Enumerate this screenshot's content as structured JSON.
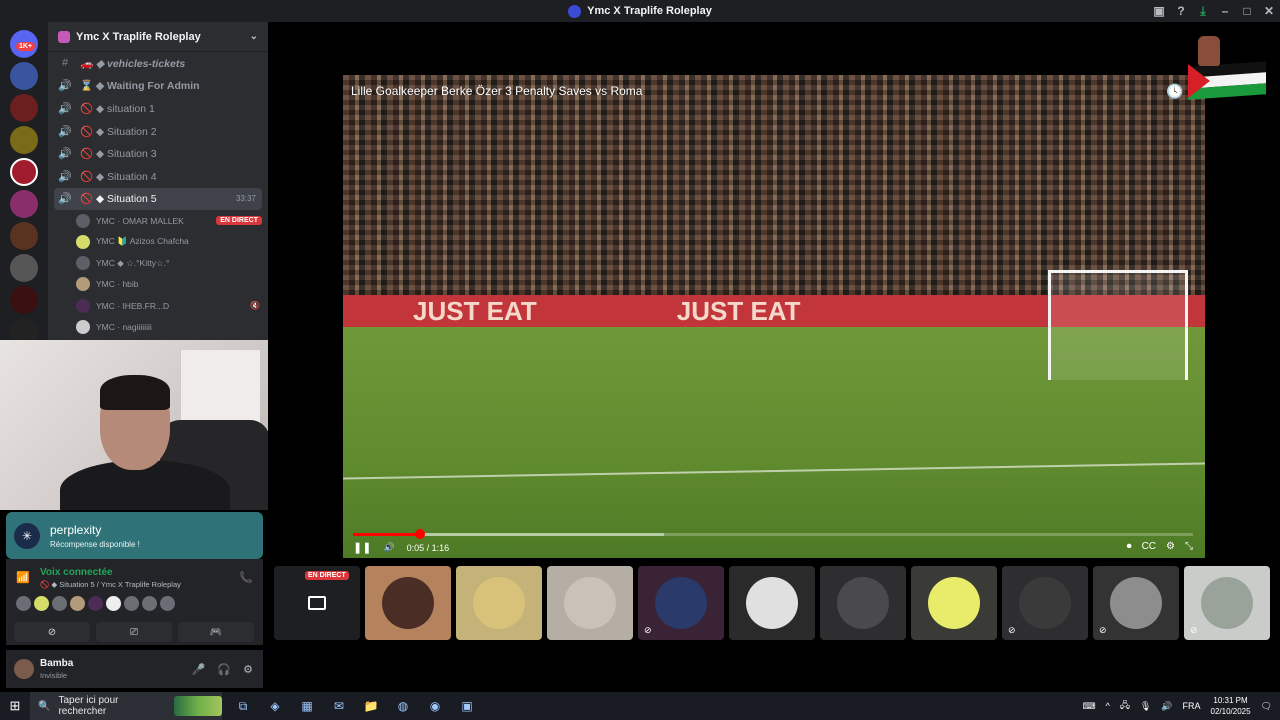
{
  "window": {
    "title": "Ymc X Traplife Roleplay"
  },
  "guilds": {
    "home_badge": "1K+"
  },
  "server": {
    "name": "Ymc X Traplife Roleplay",
    "channels": [
      {
        "label": "🚗 ◆ vehicles-tickets",
        "type": "text"
      },
      {
        "label": "⌛ ◆ Waiting For Admin",
        "type": "voice"
      },
      {
        "label": "🚫 ◆ situation 1",
        "type": "voice"
      },
      {
        "label": "🚫 ◆ Situation 2",
        "type": "voice"
      },
      {
        "label": "🚫 ◆ Situation 3",
        "type": "voice"
      },
      {
        "label": "🚫 ◆ Situation 4",
        "type": "voice"
      },
      {
        "label": "🚫 ◆ Situation 5",
        "type": "voice",
        "active": true,
        "time": "33:37"
      }
    ],
    "voice_users": [
      {
        "name": "YMC · OMAR MALLEK",
        "live": "EN DIRECT"
      },
      {
        "name": "YMC 🔰 Azizos Chafcha"
      },
      {
        "name": "YMC ◆ ☆.°Kitty☆.°"
      },
      {
        "name": "YMC · hbib"
      },
      {
        "name": "YMC · IHEB.FR...D",
        "muted": true
      },
      {
        "name": "YMC · nagiiiiiiii"
      }
    ]
  },
  "activity": {
    "app": "perplexity",
    "subtitle": "Récompense disponible !"
  },
  "voice": {
    "status": "Voix connectée",
    "channel": "🚫 ◆ Situation 5 / Ymc X Traplife Roleplay"
  },
  "user": {
    "name": "Bamba",
    "status": "Invisible"
  },
  "video": {
    "title": "Lille Goalkeeper Berke Özer 3 Penalty Saves vs Roma",
    "current_time": "0:05",
    "duration": "1:16",
    "time_display": "0:05 / 1:16",
    "progress": 0.08,
    "buffered": 0.37,
    "board_text": [
      "JUST EAT",
      "JUST EAT"
    ]
  },
  "participants": {
    "live_label": "EN DIRECT",
    "count": 10
  },
  "taskbar": {
    "search_placeholder": "Taper ici pour rechercher",
    "lang": "FRA",
    "time": "10:31 PM",
    "date": "02/10/2025"
  },
  "colors": {
    "accent_green": "#23a55a",
    "live_red": "#da373c",
    "perplexity_teal": "#2f7379"
  }
}
